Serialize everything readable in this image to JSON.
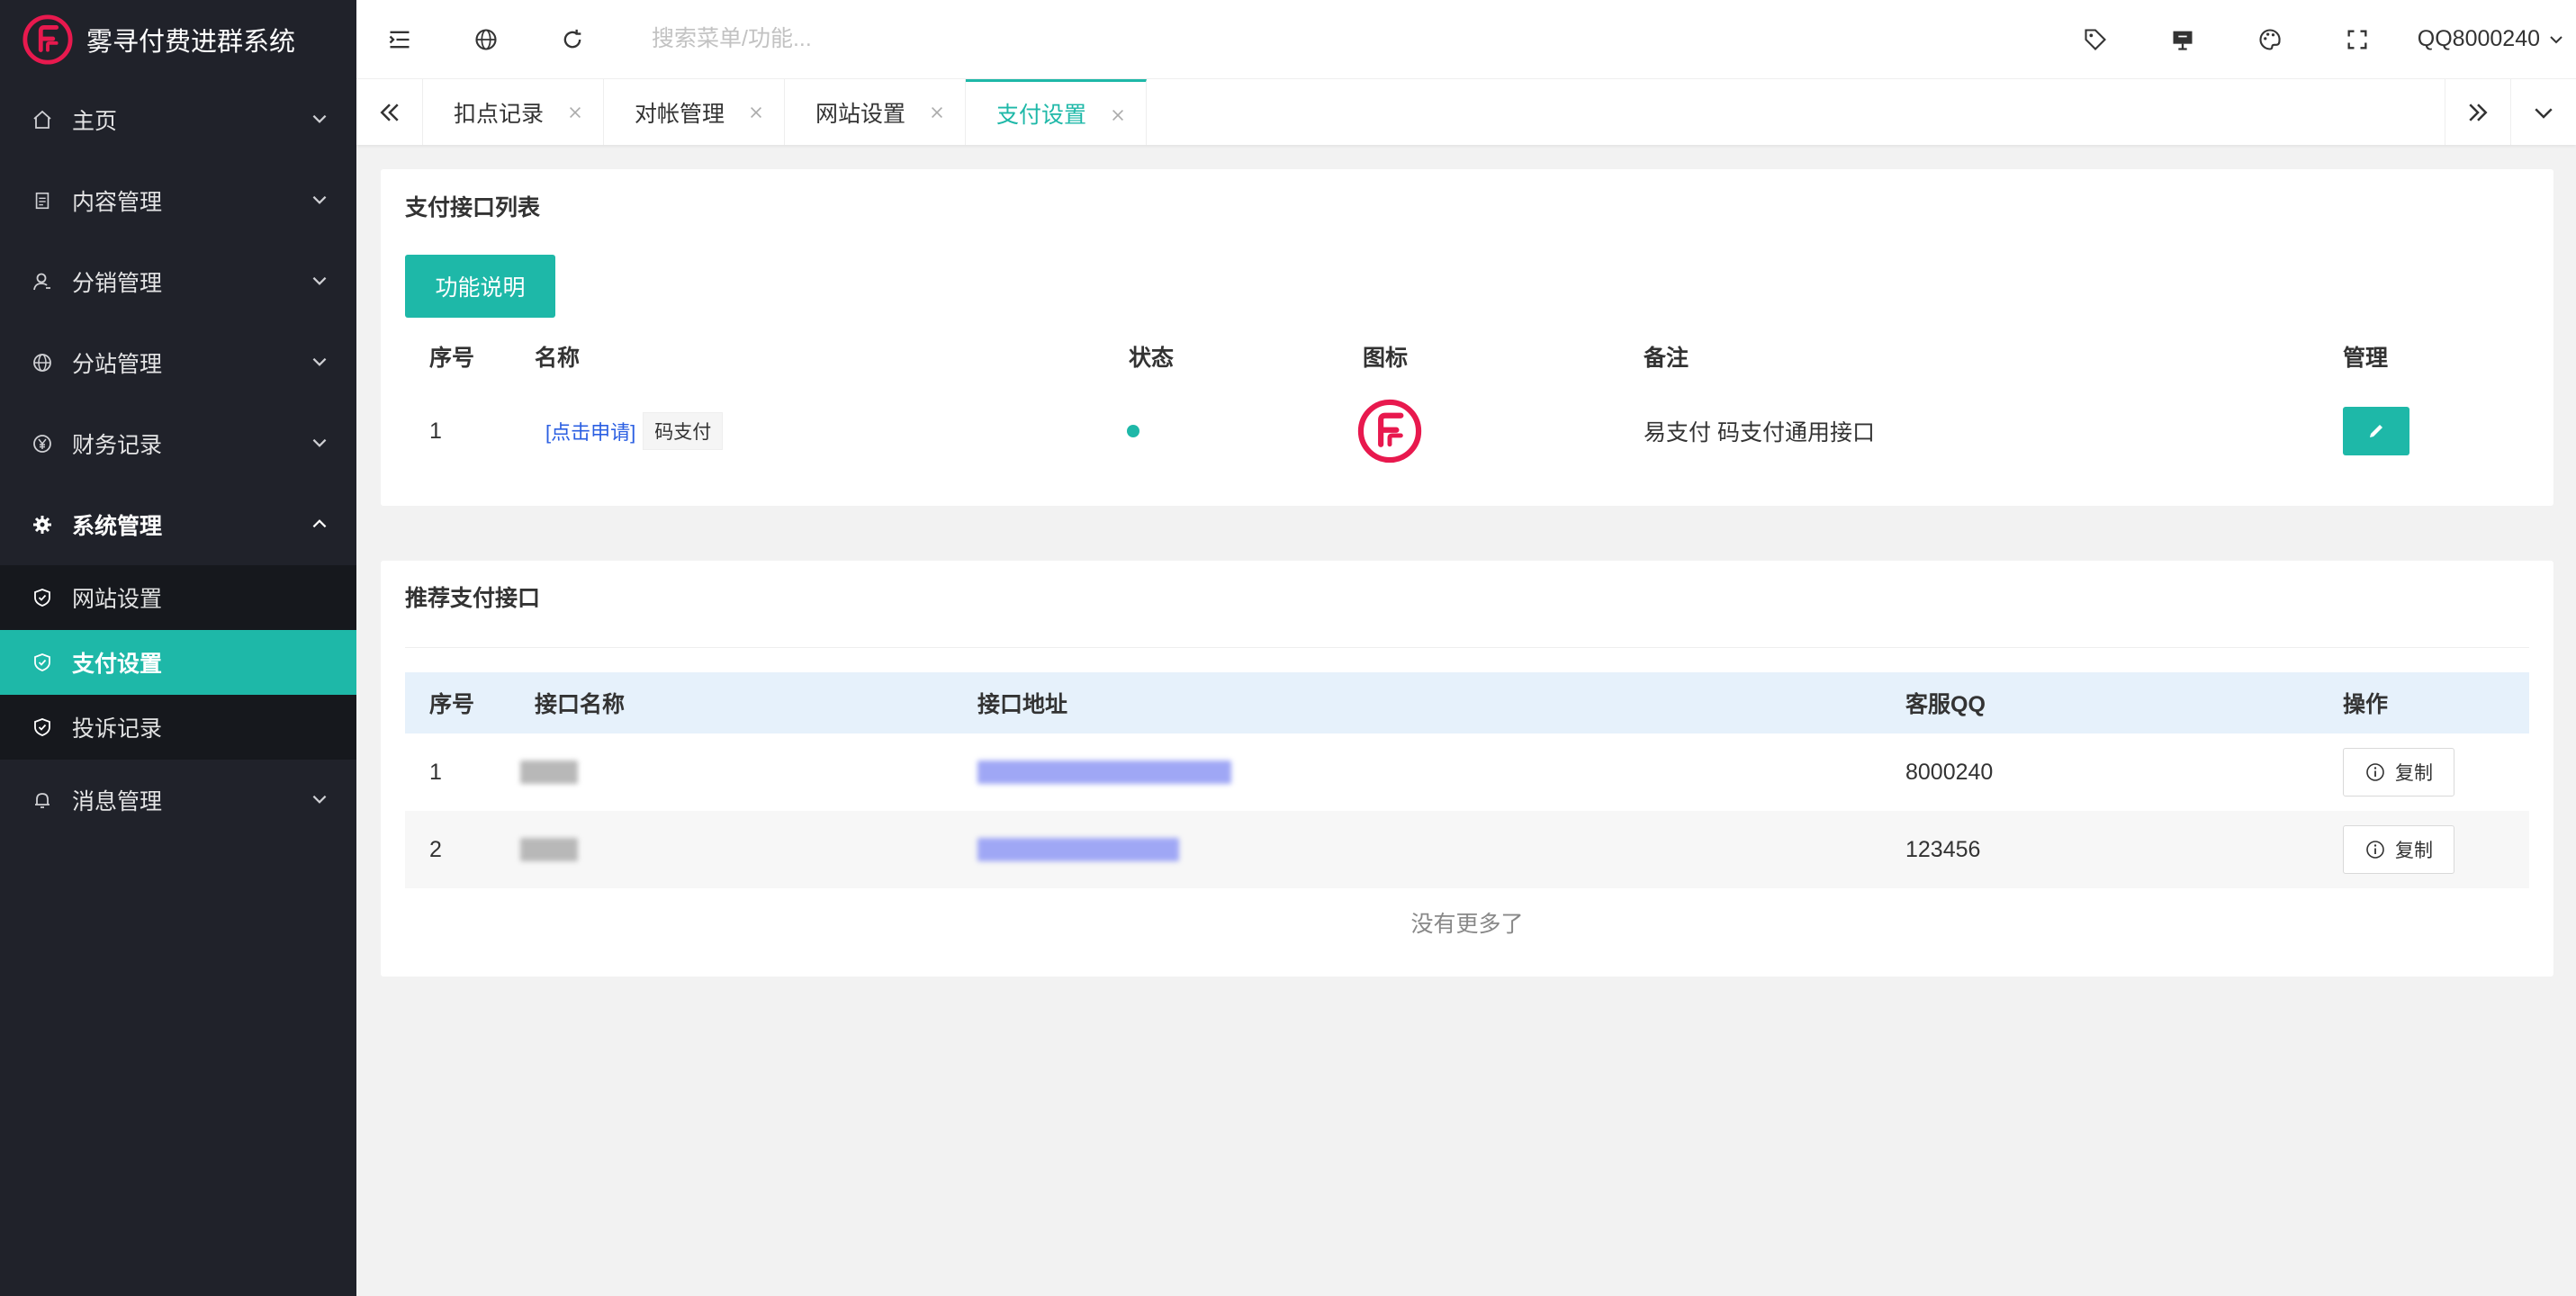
{
  "app": {
    "title": "雾寻付费进群系统"
  },
  "colors": {
    "accent": "#1eb8a8",
    "sidebar_bg": "#20222a",
    "logo_red": "#e8194e",
    "link_blue": "#2b5fe2"
  },
  "sidebar": {
    "items": [
      {
        "label": "主页",
        "icon": "home-icon"
      },
      {
        "label": "内容管理",
        "icon": "document-icon"
      },
      {
        "label": "分销管理",
        "icon": "user-icon"
      },
      {
        "label": "分站管理",
        "icon": "globe-icon"
      },
      {
        "label": "财务记录",
        "icon": "yen-icon"
      },
      {
        "label": "系统管理",
        "icon": "gear-icon",
        "expanded": true
      },
      {
        "label": "消息管理",
        "icon": "bell-icon"
      }
    ],
    "subitems": [
      {
        "label": "网站设置",
        "icon": "shield-check-icon"
      },
      {
        "label": "支付设置",
        "icon": "shield-check-icon",
        "active": true
      },
      {
        "label": "投诉记录",
        "icon": "shield-check-icon"
      }
    ]
  },
  "header": {
    "search_placeholder": "搜索菜单/功能...",
    "user": "QQ8000240"
  },
  "tabs": [
    {
      "label": "扣点记录"
    },
    {
      "label": "对帐管理"
    },
    {
      "label": "网站设置"
    },
    {
      "label": "支付设置",
      "active": true
    }
  ],
  "payment_list": {
    "title": "支付接口列表",
    "info_button": "功能说明",
    "columns": [
      "序号",
      "名称",
      "状态",
      "图标",
      "备注",
      "管理"
    ],
    "rows": [
      {
        "index": "1",
        "apply_link": "[点击申请]",
        "name": "码支付",
        "status": "enabled",
        "remark": "易支付 码支付通用接口"
      }
    ]
  },
  "recommended": {
    "title": "推荐支付接口",
    "columns": [
      "序号",
      "接口名称",
      "接口地址",
      "客服QQ",
      "操作"
    ],
    "rows": [
      {
        "index": "1",
        "qq": "8000240",
        "action": "复制"
      },
      {
        "index": "2",
        "qq": "123456",
        "action": "复制"
      }
    ],
    "footer": "没有更多了"
  }
}
